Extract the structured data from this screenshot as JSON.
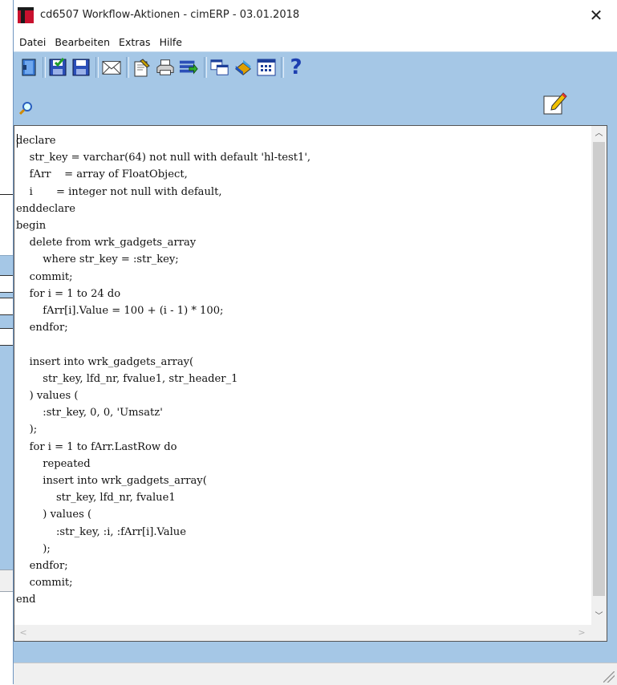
{
  "window": {
    "title": "cd6507 Workflow-Aktionen - cimERP - 03.01.2018",
    "close_symbol": "✕"
  },
  "menu": {
    "items": [
      "Datei",
      "Bearbeiten",
      "Extras",
      "Hilfe"
    ]
  },
  "toolbar": {
    "buttons": [
      "exit-door-icon",
      "save-as-icon",
      "save-icon",
      "mail-icon",
      "edit-document-icon",
      "print-icon",
      "export-icon",
      "copy-windows-icon",
      "book-icon",
      "table-icon",
      "help-icon"
    ],
    "help_glyph": "?"
  },
  "editor": {
    "code": "declare\n    str_key = varchar(64) not null with default 'hl-test1',\n    fArr    = array of FloatObject,\n    i       = integer not null with default,\nenddeclare\nbegin\n    delete from wrk_gadgets_array\n        where str_key = :str_key;\n    commit;\n    for i = 1 to 24 do\n        fArr[i].Value = 100 + (i - 1) * 100;\n    endfor;\n\n    insert into wrk_gadgets_array(\n        str_key, lfd_nr, fvalue1, str_header_1\n    ) values (\n        :str_key, 0, 0, 'Umsatz'\n    );\n    for i = 1 to fArr.LastRow do\n        repeated\n        insert into wrk_gadgets_array(\n            str_key, lfd_nr, fvalue1\n        ) values (\n            :str_key, :i, :fArr[i].Value\n        );\n    endfor;\n    commit;\nend",
    "scroll_up": "︿",
    "scroll_down": "﹀",
    "scroll_left": "<",
    "scroll_right": ">"
  },
  "colors": {
    "panel": "#a5c7e6",
    "accent_red": "#c8102e"
  }
}
